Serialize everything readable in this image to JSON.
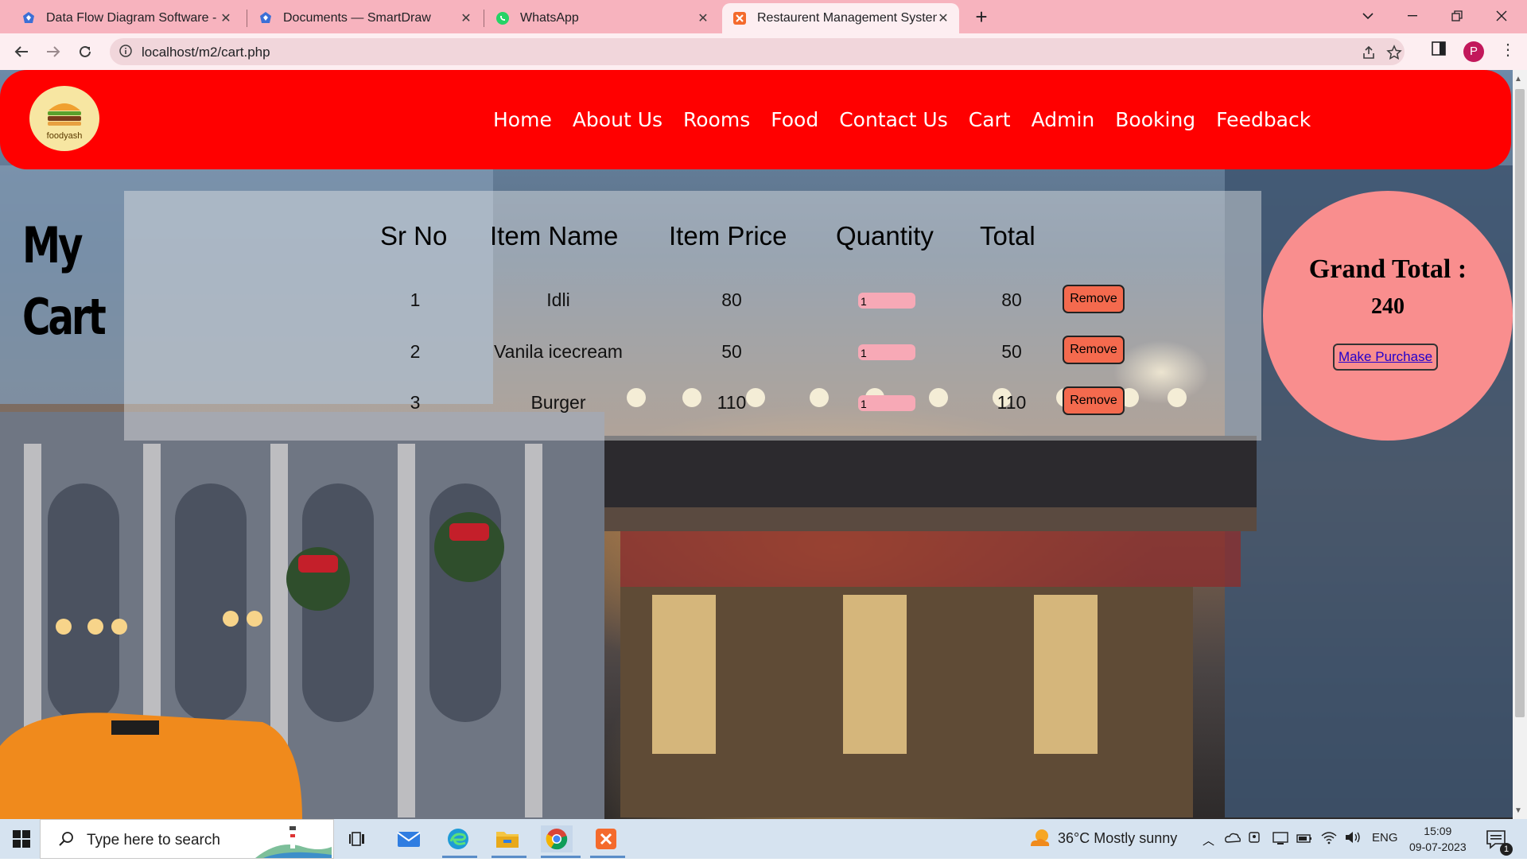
{
  "browser": {
    "tabs": [
      {
        "title": "Data Flow Diagram Software - Fr",
        "icon": "smartdraw-icon",
        "active": false
      },
      {
        "title": "Documents — SmartDraw",
        "icon": "smartdraw-icon",
        "active": false
      },
      {
        "title": "WhatsApp",
        "icon": "whatsapp-icon",
        "active": false
      },
      {
        "title": "Restaurent Management System",
        "icon": "xampp-icon",
        "active": true
      }
    ],
    "url": "localhost/m2/cart.php",
    "profile_initial": "P",
    "colors": {
      "tabbar": "#f7b3be",
      "toolbar": "#fdeef1"
    }
  },
  "site": {
    "logo_text": "foodyash",
    "nav": [
      "Home",
      "About Us",
      "Rooms",
      "Food",
      "Contact Us",
      "Cart",
      "Admin",
      "Booking",
      "Feedback"
    ],
    "colors": {
      "header": "#ff0000",
      "remove_button": "#f46a4e",
      "grand_total_circle": "#f98e8e"
    }
  },
  "cart": {
    "heading_line1": "My",
    "heading_line2": "Cart",
    "columns": [
      "Sr No",
      "Item Name",
      "Item Price",
      "Quantity",
      "Total"
    ],
    "rows": [
      {
        "sr": "1",
        "name": "Idli",
        "price": "80",
        "qty": "1",
        "total": "80",
        "action": "Remove"
      },
      {
        "sr": "2",
        "name": "Vanila icecream",
        "price": "50",
        "qty": "1",
        "total": "50",
        "action": "Remove"
      },
      {
        "sr": "3",
        "name": "Burger",
        "price": "110",
        "qty": "1",
        "total": "110",
        "action": "Remove"
      }
    ]
  },
  "summary": {
    "label": "Grand Total :",
    "value": "240",
    "purchase_label": "Make Purchase"
  },
  "taskbar": {
    "search_placeholder": "Type here to search",
    "weather": "36°C  Mostly sunny",
    "language": "ENG",
    "time": "15:09",
    "date": "09-07-2023",
    "notification_count": "1",
    "pinned": [
      "task-view-icon",
      "mail-icon",
      "edge-icon",
      "file-explorer-icon",
      "chrome-icon",
      "xampp-icon"
    ]
  }
}
